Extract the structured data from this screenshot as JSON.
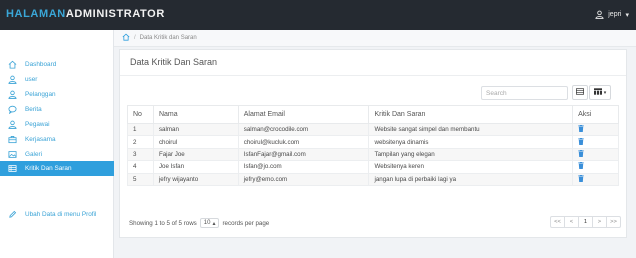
{
  "header": {
    "brand_accent": "HALAMAN",
    "brand_main": "ADMINISTRATOR",
    "user_name": "jepri",
    "user_caret": "▾"
  },
  "sidebar": {
    "items": [
      {
        "label": "Dashboard",
        "icon": "home-icon"
      },
      {
        "label": "user",
        "icon": "user-icon"
      },
      {
        "label": "Pelanggan",
        "icon": "user-icon"
      },
      {
        "label": "Berita",
        "icon": "comment-icon"
      },
      {
        "label": "Pegawai",
        "icon": "user-icon"
      },
      {
        "label": "Kerjasama",
        "icon": "briefcase-icon"
      },
      {
        "label": "Galeri",
        "icon": "gallery-icon"
      },
      {
        "label": "Kritik Dan Saran",
        "icon": "list-icon",
        "active": true
      },
      {
        "label": "Ubah Data di menu Profil",
        "icon": "pencil-icon"
      }
    ]
  },
  "breadcrumb": {
    "sep": "/",
    "current": "Data Kritik dan Saran"
  },
  "panel": {
    "title": "Data Kritik Dan Saran"
  },
  "search": {
    "placeholder": "Search"
  },
  "table": {
    "headers": [
      "No",
      "Nama",
      "Alamat Email",
      "Kritik Dan Saran",
      "Aksi"
    ],
    "rows": [
      {
        "no": "1",
        "nama": "salman",
        "email": "salman@crocodile.com",
        "kritik": "Website sangat simpel dan membantu"
      },
      {
        "no": "2",
        "nama": "choirul",
        "email": "choirul@kucluk.com",
        "kritik": "websitenya dinamis"
      },
      {
        "no": "3",
        "nama": "Fajar Joe",
        "email": "IsfanFajar@gmail.com",
        "kritik": "Tampilan yang elegan"
      },
      {
        "no": "4",
        "nama": "Joe Isfan",
        "email": "Isfan@jo.com",
        "kritik": "Websitenya keren"
      },
      {
        "no": "5",
        "nama": "jefry wijayanto",
        "email": "jefry@emo.com",
        "kritik": "jangan lupa di perbaiki lagi ya"
      }
    ]
  },
  "footer": {
    "showing": "Showing 1 to 5 of 5 rows",
    "page_size": "10",
    "page_size_caret": "▴",
    "records_label": "records per page"
  },
  "pagination": {
    "first": "<<",
    "prev": "<",
    "current": "1",
    "next": ">",
    "last": ">>"
  },
  "colors": {
    "accent": "#2f9fdd",
    "topbar": "#252a31",
    "brand_accent": "#3aa7d8",
    "delete_icon": "#3a8fd9"
  }
}
